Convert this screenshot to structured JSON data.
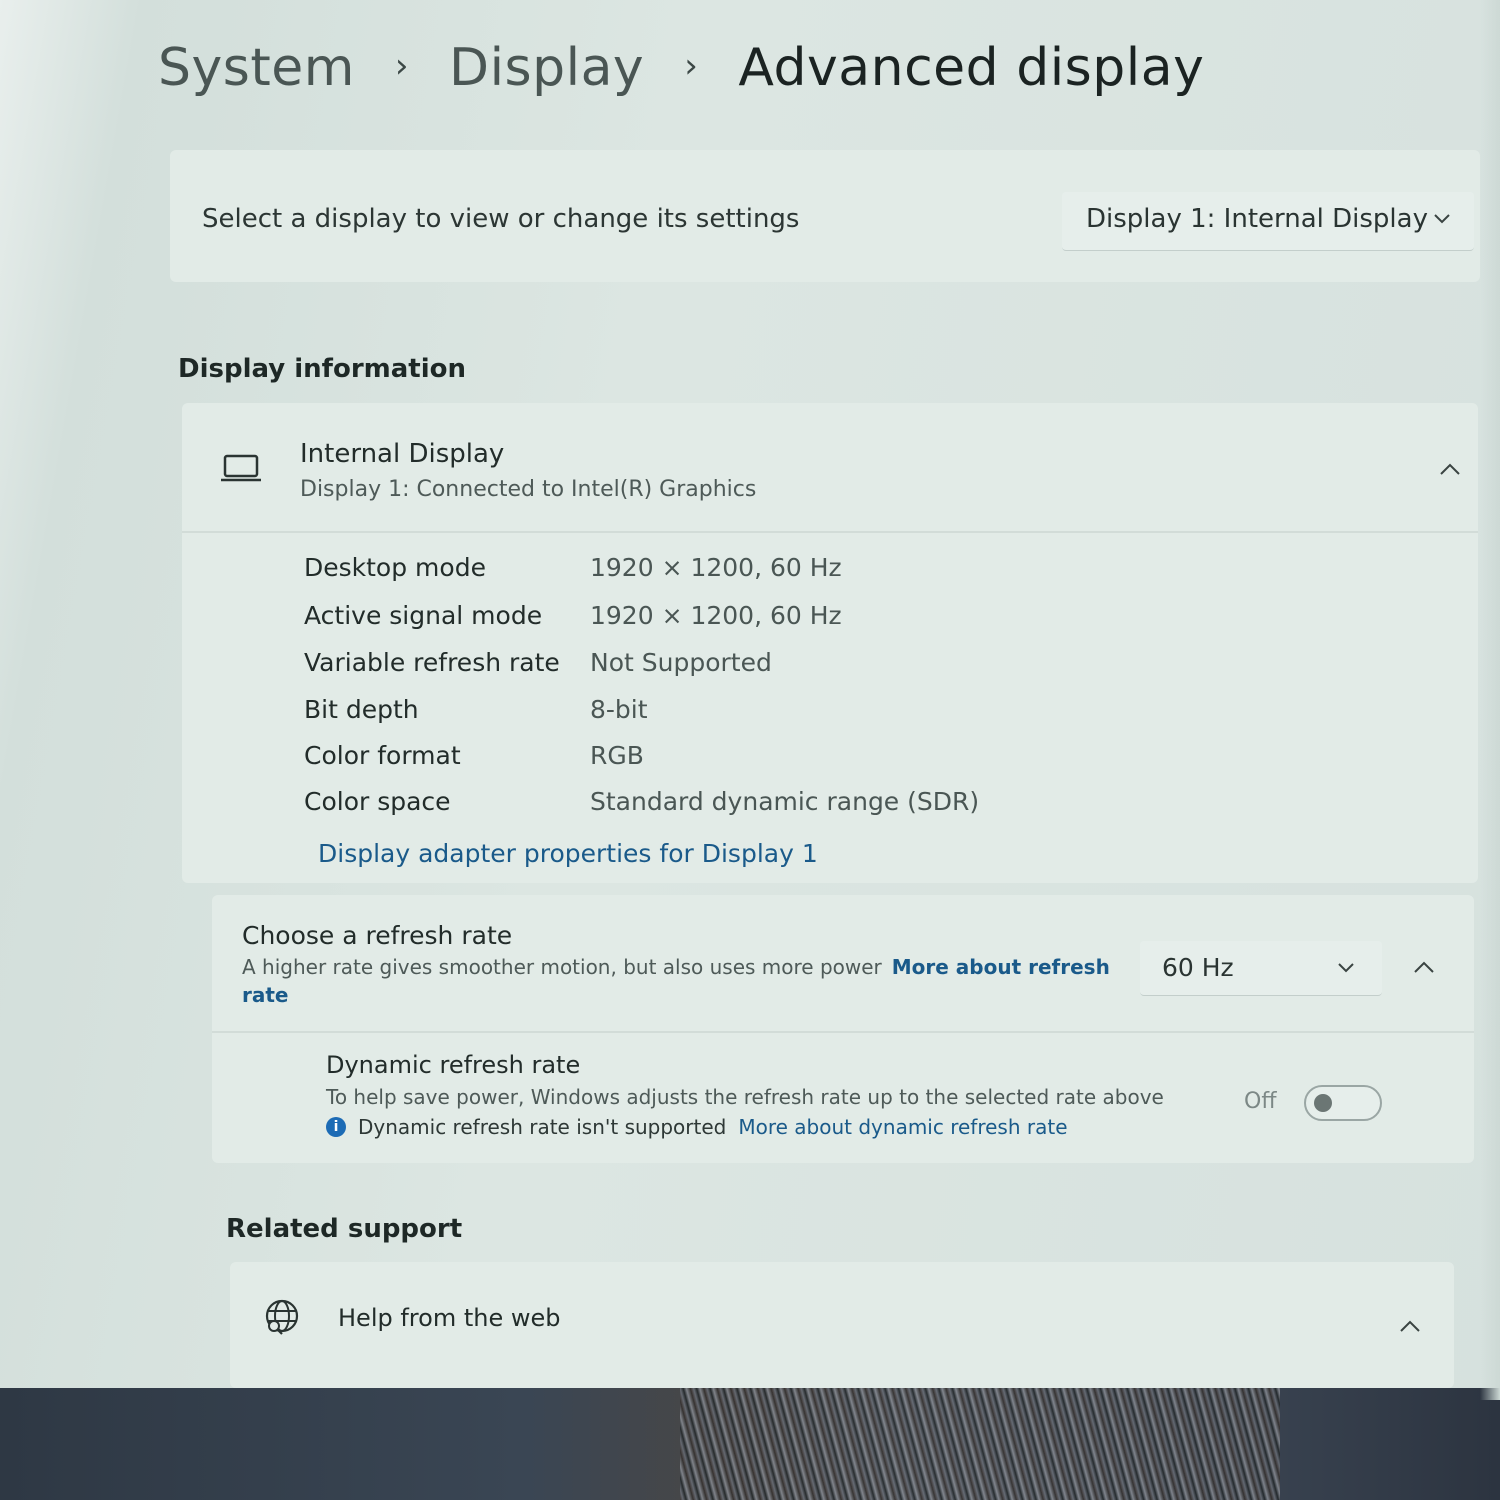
{
  "breadcrumb": {
    "items": [
      "System",
      "Display",
      "Advanced display"
    ]
  },
  "display_select": {
    "label": "Select a display to view or change its settings",
    "value": "Display 1: Internal Display"
  },
  "display_information": {
    "section_title": "Display information",
    "device_title": "Internal Display",
    "device_subtitle": "Display 1: Connected to Intel(R) Graphics",
    "properties": [
      {
        "label": "Desktop mode",
        "value": "1920 × 1200, 60 Hz"
      },
      {
        "label": "Active signal mode",
        "value": "1920 × 1200, 60 Hz"
      },
      {
        "label": "Variable refresh rate",
        "value": "Not Supported"
      },
      {
        "label": "Bit depth",
        "value": "8-bit"
      },
      {
        "label": "Color format",
        "value": "RGB"
      },
      {
        "label": "Color space",
        "value": "Standard dynamic range (SDR)"
      }
    ],
    "adapter_link": "Display adapter properties for Display 1"
  },
  "refresh_rate": {
    "title": "Choose a refresh rate",
    "description": "A higher rate gives smoother motion, but also uses more power",
    "more_link": "More about refresh rate",
    "selected": "60 Hz",
    "dynamic": {
      "title": "Dynamic refresh rate",
      "description": "To help save power, Windows adjusts the refresh rate up to the selected rate above",
      "note": "Dynamic refresh rate isn't supported",
      "note_link": "More about dynamic refresh rate",
      "toggle_label": "Off"
    }
  },
  "related_support": {
    "section_title": "Related support",
    "help_item": "Help from the web"
  },
  "icons": {
    "laptop": "laptop-icon",
    "globe": "globe-icon",
    "info": "info-icon"
  },
  "colors": {
    "link": "#1a5a8a",
    "info_icon": "#1c6bb5"
  }
}
